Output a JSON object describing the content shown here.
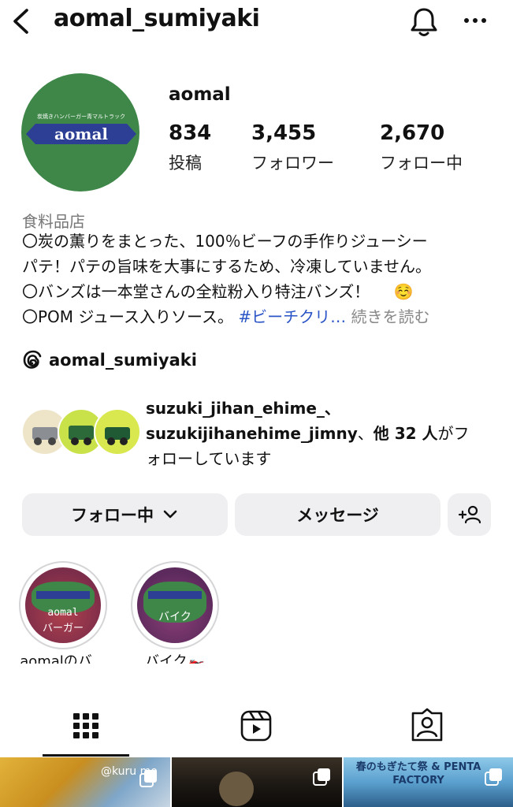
{
  "header": {
    "username": "aomal_sumiyaki",
    "back_icon": "chevron-left-icon",
    "notification_icon": "bell-icon",
    "more_icon": "ellipsis-icon"
  },
  "profile": {
    "display_name": "aomal",
    "avatar_logo_text": "aomal",
    "avatar_small_text": "炭焼きハンバーガー青マルトラック",
    "avatar_bg_color": "#3f8748",
    "stats": [
      {
        "value": "834",
        "label": "投稿"
      },
      {
        "value": "3,455",
        "label": "フォロワー"
      },
      {
        "value": "2,670",
        "label": "フォロー中"
      }
    ],
    "category": "食料品店",
    "bio": [
      "〇炭の薫りをまとった、100％ビーフの手作りジューシー",
      "パテ！パテの旨味を大事にするため、冷凍していません。",
      "〇バンズは一本堂さんの全粒粉入り特注バンズ！",
      "〇POM ジュース入りソース。"
    ],
    "bio_emoji": "☺️",
    "bio_hashtag": "#ビーチクリ…",
    "bio_more": "続きを読む",
    "threads_handle": "aomal_sumiyaki"
  },
  "mutual": {
    "line1": "suzuki_jihan_ehime_、",
    "line2_names": "suzukijihanehime_jimny",
    "line2_mid": "、",
    "line2_bold": "他 32 人",
    "line2_end": "がフ",
    "line3": "ォローしています"
  },
  "actions": {
    "follow_label": "フォロー中",
    "message_label": "メッセージ",
    "add_person_icon": "add-person-icon"
  },
  "highlights": [
    {
      "title": "aomalのバ…",
      "cover_line1": "aomal",
      "cover_line2": "バーガー"
    },
    {
      "title": "バイク🏍️",
      "cover_line1": "バイク",
      "cover_line2": ""
    }
  ],
  "tabs": [
    {
      "name": "grid",
      "icon": "grid-icon",
      "active": true
    },
    {
      "name": "reels",
      "icon": "reels-icon",
      "active": false
    },
    {
      "name": "tagged",
      "icon": "tagged-icon",
      "active": false
    }
  ],
  "posts": [
    {
      "overlay_text": "@kuru mo"
    },
    {
      "overlay_text": ""
    },
    {
      "overlay_text": "春のもぎたて祭 & PENTA FACTORY"
    }
  ]
}
